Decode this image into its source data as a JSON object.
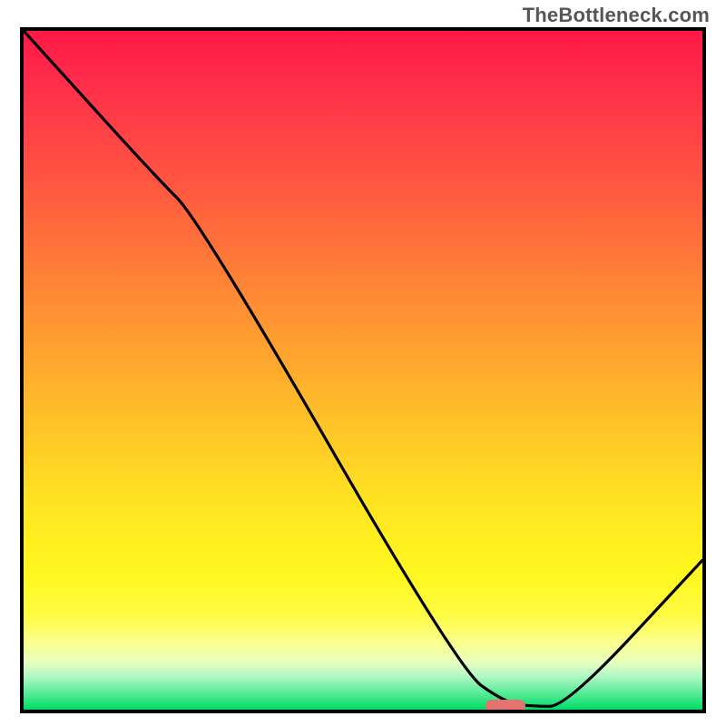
{
  "watermark": "TheBottleneck.com",
  "chart_data": {
    "type": "line",
    "title": "",
    "xlabel": "",
    "ylabel": "",
    "xlim": [
      0,
      100
    ],
    "ylim": [
      0,
      100
    ],
    "series": [
      {
        "name": "curve",
        "x": [
          0,
          19,
          26,
          64,
          71,
          75,
          80,
          100
        ],
        "values": [
          100,
          79,
          72,
          6,
          1,
          0.5,
          0.5,
          22
        ]
      }
    ],
    "marker": {
      "x": 71,
      "y": 0.5
    },
    "grid": false,
    "legend": false
  },
  "colors": {
    "gradient_top": "#ff1846",
    "gradient_bottom": "#00d865",
    "curve": "#000000",
    "marker": "#e5726e",
    "frame": "#000000",
    "watermark": "#565656"
  }
}
